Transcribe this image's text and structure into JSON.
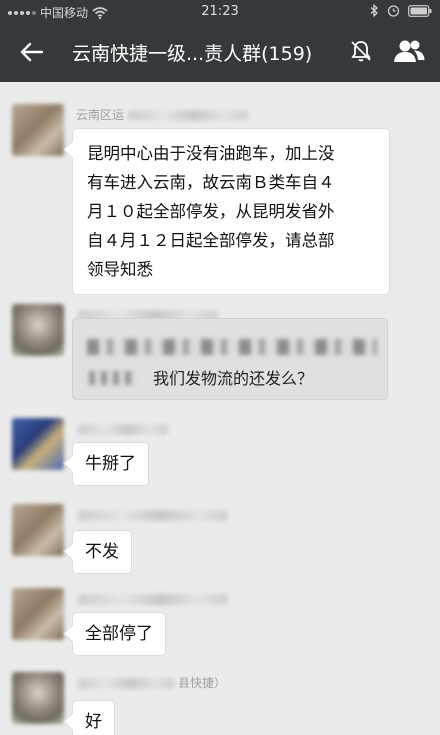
{
  "status_bar": {
    "carrier": "中国移动",
    "time": "21:23",
    "icons": [
      "wifi-icon",
      "bluetooth-icon",
      "alarm-icon",
      "battery-icon"
    ]
  },
  "nav": {
    "title": "云南快捷一级...责人群(159)",
    "icons": [
      "back-arrow-icon",
      "mute-icon",
      "group-members-icon"
    ]
  },
  "messages": [
    {
      "sender": "云南区运",
      "text_lines": [
        "昆明中心由于没有油跑车，加上没",
        "有车进入云南，故云南Ｂ类车自４",
        "月１０起全部停发，从昆明发省外",
        "自４月１２日起全部停发，请总部",
        "领导知悉"
      ]
    },
    {
      "sender": "",
      "quoted": true,
      "text": "我们发物流的还发么？"
    },
    {
      "sender": "",
      "text": "牛掰了"
    },
    {
      "sender": "",
      "text": "不发"
    },
    {
      "sender": "",
      "text": "全部停了"
    },
    {
      "sender": "县快捷）",
      "text": "好"
    }
  ],
  "colors": {
    "bar_bg": "#35393c",
    "chat_bg": "#ebebeb",
    "bubble_bg": "#ffffff"
  }
}
